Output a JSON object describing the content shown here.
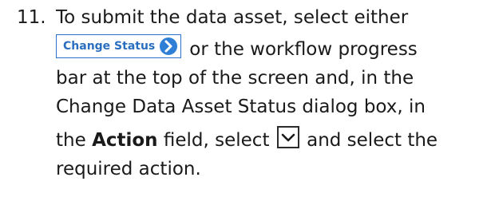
{
  "step": {
    "number": "11.",
    "line1": "To submit the data asset, select either",
    "button_label": "Change Status",
    "line2_after_button": "or the workflow progress",
    "line3": "bar at the top of the screen and, in the",
    "line4": "Change Data Asset Status dialog box, in",
    "line5_before_bold": "the ",
    "line5_bold": "Action",
    "line5_after_bold": " field, select",
    "line5_after_icon": "and select the",
    "line6": "required action."
  },
  "icons": {
    "change_status_chevron": "chevron-right-circle-icon",
    "dropdown": "chevron-down-icon"
  },
  "colors": {
    "button_text": "#2a6ebf",
    "button_border": "#2b74c9",
    "chevron_circle": "#2f7fd6"
  }
}
